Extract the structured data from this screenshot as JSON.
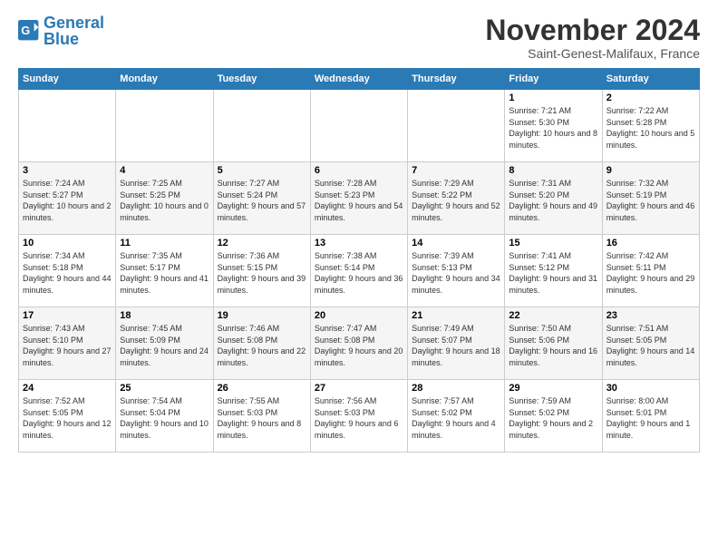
{
  "logo": {
    "line1": "General",
    "line2": "Blue"
  },
  "title": "November 2024",
  "location": "Saint-Genest-Malifaux, France",
  "weekdays": [
    "Sunday",
    "Monday",
    "Tuesday",
    "Wednesday",
    "Thursday",
    "Friday",
    "Saturday"
  ],
  "weeks": [
    [
      {
        "day": "",
        "info": ""
      },
      {
        "day": "",
        "info": ""
      },
      {
        "day": "",
        "info": ""
      },
      {
        "day": "",
        "info": ""
      },
      {
        "day": "",
        "info": ""
      },
      {
        "day": "1",
        "info": "Sunrise: 7:21 AM\nSunset: 5:30 PM\nDaylight: 10 hours and 8 minutes."
      },
      {
        "day": "2",
        "info": "Sunrise: 7:22 AM\nSunset: 5:28 PM\nDaylight: 10 hours and 5 minutes."
      }
    ],
    [
      {
        "day": "3",
        "info": "Sunrise: 7:24 AM\nSunset: 5:27 PM\nDaylight: 10 hours and 2 minutes."
      },
      {
        "day": "4",
        "info": "Sunrise: 7:25 AM\nSunset: 5:25 PM\nDaylight: 10 hours and 0 minutes."
      },
      {
        "day": "5",
        "info": "Sunrise: 7:27 AM\nSunset: 5:24 PM\nDaylight: 9 hours and 57 minutes."
      },
      {
        "day": "6",
        "info": "Sunrise: 7:28 AM\nSunset: 5:23 PM\nDaylight: 9 hours and 54 minutes."
      },
      {
        "day": "7",
        "info": "Sunrise: 7:29 AM\nSunset: 5:22 PM\nDaylight: 9 hours and 52 minutes."
      },
      {
        "day": "8",
        "info": "Sunrise: 7:31 AM\nSunset: 5:20 PM\nDaylight: 9 hours and 49 minutes."
      },
      {
        "day": "9",
        "info": "Sunrise: 7:32 AM\nSunset: 5:19 PM\nDaylight: 9 hours and 46 minutes."
      }
    ],
    [
      {
        "day": "10",
        "info": "Sunrise: 7:34 AM\nSunset: 5:18 PM\nDaylight: 9 hours and 44 minutes."
      },
      {
        "day": "11",
        "info": "Sunrise: 7:35 AM\nSunset: 5:17 PM\nDaylight: 9 hours and 41 minutes."
      },
      {
        "day": "12",
        "info": "Sunrise: 7:36 AM\nSunset: 5:15 PM\nDaylight: 9 hours and 39 minutes."
      },
      {
        "day": "13",
        "info": "Sunrise: 7:38 AM\nSunset: 5:14 PM\nDaylight: 9 hours and 36 minutes."
      },
      {
        "day": "14",
        "info": "Sunrise: 7:39 AM\nSunset: 5:13 PM\nDaylight: 9 hours and 34 minutes."
      },
      {
        "day": "15",
        "info": "Sunrise: 7:41 AM\nSunset: 5:12 PM\nDaylight: 9 hours and 31 minutes."
      },
      {
        "day": "16",
        "info": "Sunrise: 7:42 AM\nSunset: 5:11 PM\nDaylight: 9 hours and 29 minutes."
      }
    ],
    [
      {
        "day": "17",
        "info": "Sunrise: 7:43 AM\nSunset: 5:10 PM\nDaylight: 9 hours and 27 minutes."
      },
      {
        "day": "18",
        "info": "Sunrise: 7:45 AM\nSunset: 5:09 PM\nDaylight: 9 hours and 24 minutes."
      },
      {
        "day": "19",
        "info": "Sunrise: 7:46 AM\nSunset: 5:08 PM\nDaylight: 9 hours and 22 minutes."
      },
      {
        "day": "20",
        "info": "Sunrise: 7:47 AM\nSunset: 5:08 PM\nDaylight: 9 hours and 20 minutes."
      },
      {
        "day": "21",
        "info": "Sunrise: 7:49 AM\nSunset: 5:07 PM\nDaylight: 9 hours and 18 minutes."
      },
      {
        "day": "22",
        "info": "Sunrise: 7:50 AM\nSunset: 5:06 PM\nDaylight: 9 hours and 16 minutes."
      },
      {
        "day": "23",
        "info": "Sunrise: 7:51 AM\nSunset: 5:05 PM\nDaylight: 9 hours and 14 minutes."
      }
    ],
    [
      {
        "day": "24",
        "info": "Sunrise: 7:52 AM\nSunset: 5:05 PM\nDaylight: 9 hours and 12 minutes."
      },
      {
        "day": "25",
        "info": "Sunrise: 7:54 AM\nSunset: 5:04 PM\nDaylight: 9 hours and 10 minutes."
      },
      {
        "day": "26",
        "info": "Sunrise: 7:55 AM\nSunset: 5:03 PM\nDaylight: 9 hours and 8 minutes."
      },
      {
        "day": "27",
        "info": "Sunrise: 7:56 AM\nSunset: 5:03 PM\nDaylight: 9 hours and 6 minutes."
      },
      {
        "day": "28",
        "info": "Sunrise: 7:57 AM\nSunset: 5:02 PM\nDaylight: 9 hours and 4 minutes."
      },
      {
        "day": "29",
        "info": "Sunrise: 7:59 AM\nSunset: 5:02 PM\nDaylight: 9 hours and 2 minutes."
      },
      {
        "day": "30",
        "info": "Sunrise: 8:00 AM\nSunset: 5:01 PM\nDaylight: 9 hours and 1 minute."
      }
    ]
  ]
}
